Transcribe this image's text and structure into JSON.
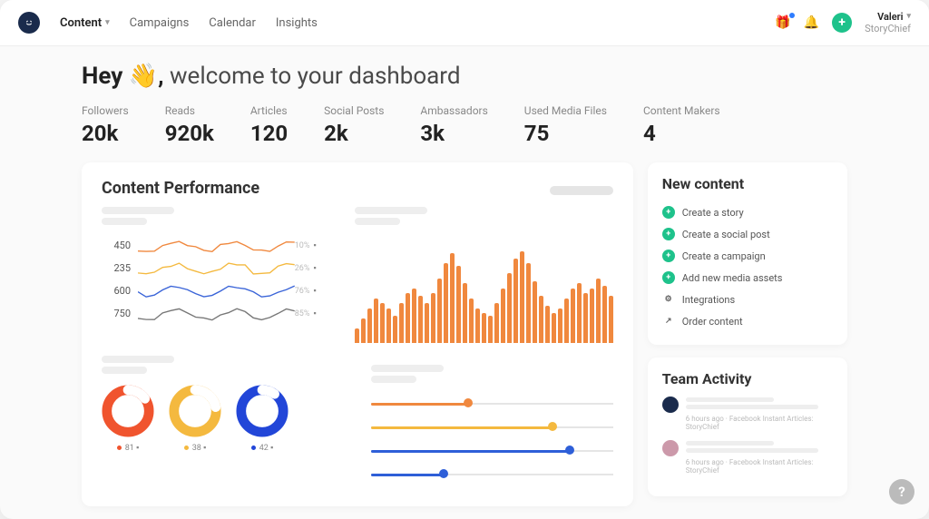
{
  "nav": {
    "items": [
      "Content",
      "Campaigns",
      "Calendar",
      "Insights"
    ]
  },
  "user": {
    "name": "Valeri",
    "org": "StoryChief"
  },
  "welcome": {
    "prefix": "Hey 👋,",
    "suffix": " welcome to your dashboard"
  },
  "stats": [
    {
      "label": "Followers",
      "value": "20k"
    },
    {
      "label": "Reads",
      "value": "920k"
    },
    {
      "label": "Articles",
      "value": "120"
    },
    {
      "label": "Social Posts",
      "value": "2k"
    },
    {
      "label": "Ambassadors",
      "value": "3k"
    },
    {
      "label": "Used Media Files",
      "value": "75"
    },
    {
      "label": "Content Makers",
      "value": "4"
    }
  ],
  "perf": {
    "title": "Content Performance",
    "lines": [
      {
        "value": "450",
        "pct": "10%",
        "color": "#f0883e"
      },
      {
        "value": "235",
        "pct": "26%",
        "color": "#f4b93f"
      },
      {
        "value": "600",
        "pct": "76%",
        "color": "#3a64d8"
      },
      {
        "value": "750",
        "pct": "85%",
        "color": "#777"
      }
    ],
    "rings": [
      {
        "color": "#f0542e",
        "label": "81",
        "fill": 0.85
      },
      {
        "color": "#f4b93f",
        "label": "38",
        "fill": 0.78
      },
      {
        "color": "#2246d8",
        "label": "42",
        "fill": 0.9
      }
    ],
    "sliders": [
      {
        "color": "#f0883e",
        "fill": 0.4
      },
      {
        "color": "#f4b93f",
        "fill": 0.75
      },
      {
        "color": "#2e5fd8",
        "fill": 0.82
      },
      {
        "color": "#2e5fd8",
        "fill": 0.3
      }
    ]
  },
  "newContent": {
    "title": "New content",
    "items": [
      {
        "label": "Create a story",
        "type": "create"
      },
      {
        "label": "Create a social post",
        "type": "create"
      },
      {
        "label": "Create a campaign",
        "type": "create"
      },
      {
        "label": "Add new media assets",
        "type": "create"
      },
      {
        "label": "Integrations",
        "type": "settings"
      },
      {
        "label": "Order content",
        "type": "order"
      }
    ]
  },
  "teamActivity": {
    "title": "Team Activity",
    "items": [
      {
        "meta": "6 hours ago · Facebook Instant Articles: StoryChief"
      },
      {
        "meta": "6 hours ago · Facebook Instant Articles: StoryChief"
      }
    ]
  },
  "colors": {
    "green": "#1ec28b",
    "orange": "#f0883e",
    "blue": "#2e5fd8"
  },
  "chart_data": {
    "type": "bar",
    "title": "Content Performance",
    "note": "bar heights are relative (0-1), no axis labels visible",
    "values": [
      0.15,
      0.25,
      0.35,
      0.45,
      0.4,
      0.35,
      0.28,
      0.4,
      0.5,
      0.55,
      0.48,
      0.4,
      0.5,
      0.65,
      0.8,
      0.9,
      0.78,
      0.6,
      0.45,
      0.35,
      0.3,
      0.28,
      0.4,
      0.55,
      0.7,
      0.85,
      0.92,
      0.8,
      0.62,
      0.48,
      0.38,
      0.3,
      0.35,
      0.45,
      0.55,
      0.6,
      0.5,
      0.55,
      0.65,
      0.58,
      0.48
    ]
  }
}
